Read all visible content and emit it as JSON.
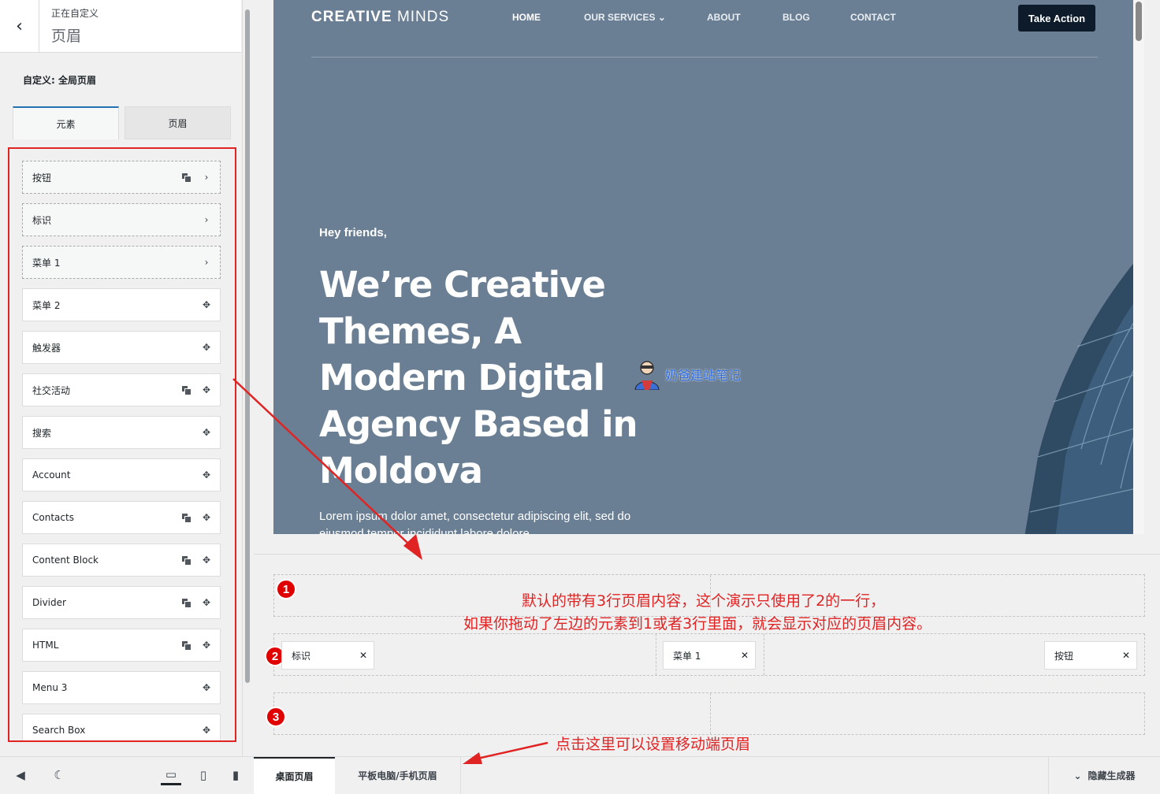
{
  "sidebar": {
    "subtitle": "正在自定义",
    "title": "页眉",
    "section_title": "自定义: 全局页眉",
    "tabs": [
      {
        "label": "元素"
      },
      {
        "label": "页眉"
      }
    ],
    "items": [
      {
        "label": "按钮"
      },
      {
        "label": "标识"
      },
      {
        "label": "菜单 1"
      },
      {
        "label": "菜单 2"
      },
      {
        "label": "触发器"
      },
      {
        "label": "社交活动"
      },
      {
        "label": "搜索"
      },
      {
        "label": "Account"
      },
      {
        "label": "Contacts"
      },
      {
        "label": "Content Block"
      },
      {
        "label": "Divider"
      },
      {
        "label": "HTML"
      },
      {
        "label": "Menu 3"
      },
      {
        "label": "Search Box"
      }
    ]
  },
  "preview": {
    "logo_bold": "CREATIVE",
    "logo_light": " MINDS",
    "nav": [
      "HOME",
      "OUR SERVICES",
      "ABOUT",
      "BLOG",
      "CONTACT"
    ],
    "cta": "Take Action",
    "greeting": "Hey friends,",
    "hero_title": "We’re Creative Themes, A Modern Digital Agency Based in Moldova",
    "hero_text": "Lorem ipsum dolor amet, consectetur adipiscing elit, sed do eiusmod tempor incididunt labore dolore",
    "watermark": "奶爸建站笔记"
  },
  "builder": {
    "badges": [
      "1",
      "2",
      "3"
    ],
    "chips": [
      {
        "label": "标识"
      },
      {
        "label": "菜单 1"
      },
      {
        "label": "按钮"
      }
    ],
    "note_line1": "默认的带有3行页眉内容，这个演示只使用了2的一行，",
    "note_line2": "如果你拖动了左边的元素到1或者3行里面，就会显示对应的页眉内容。",
    "note_mobile": "点击这里可以设置移动端页眉"
  },
  "bottom_bar": {
    "desktop_tab": "桌面页眉",
    "mobile_tab": "平板电脑/手机页眉",
    "hide_builder": "隐藏生成器"
  },
  "colors": {
    "annotation_red": "#e02424",
    "hero_bg": "#6b7f94",
    "cta_bg": "#0d1b2a"
  }
}
